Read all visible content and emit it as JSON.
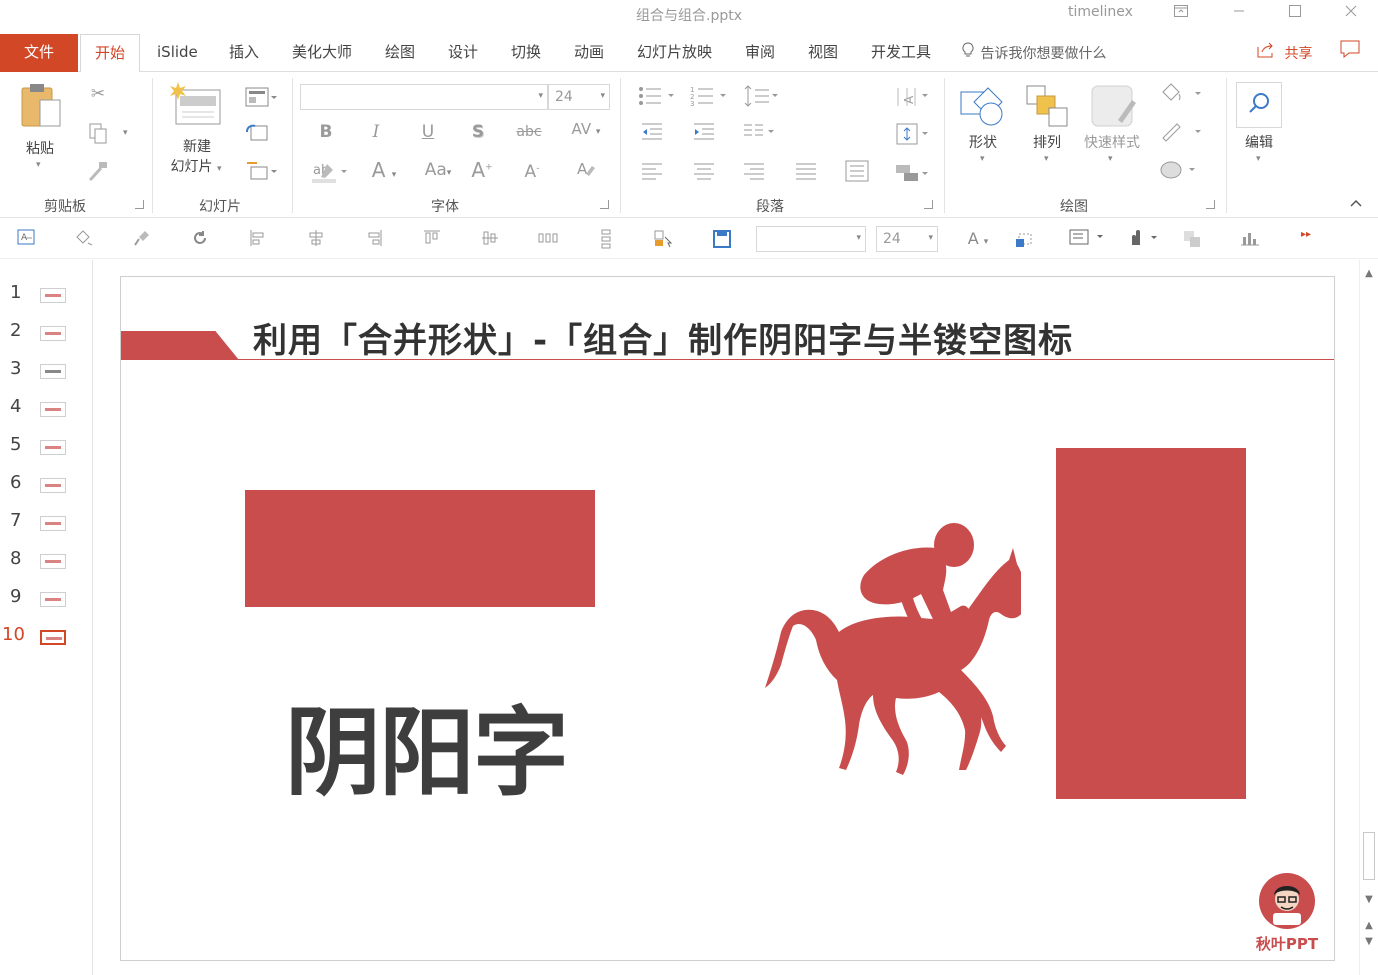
{
  "window": {
    "title": "组合与组合.pptx",
    "user": "timelinex"
  },
  "tabs": {
    "file": "文件",
    "home": "开始",
    "islide": "iSlide",
    "insert": "插入",
    "beautify": "美化大师",
    "draw": "绘图",
    "design": "设计",
    "transitions": "切换",
    "animations": "动画",
    "slideshow": "幻灯片放映",
    "review": "审阅",
    "view": "视图",
    "developer": "开发工具",
    "tell_me": "告诉我你想要做什么",
    "share": "共享"
  },
  "ribbon": {
    "clipboard": {
      "paste": "粘贴",
      "label": "剪贴板"
    },
    "slides": {
      "new_slide_line1": "新建",
      "new_slide_line2": "幻灯片",
      "label": "幻灯片"
    },
    "font": {
      "size": "24",
      "label": "字体",
      "change_case": "Aa",
      "spacing": "AV"
    },
    "paragraph": {
      "label": "段落"
    },
    "drawing": {
      "shapes": "形状",
      "arrange": "排列",
      "quick_styles": "快速样式",
      "label": "绘图"
    },
    "editing": {
      "label": "编辑"
    }
  },
  "qat": {
    "font_size": "24"
  },
  "thumbnails": [
    {
      "num": "1"
    },
    {
      "num": "2"
    },
    {
      "num": "3"
    },
    {
      "num": "4"
    },
    {
      "num": "5"
    },
    {
      "num": "6"
    },
    {
      "num": "7"
    },
    {
      "num": "8"
    },
    {
      "num": "9"
    },
    {
      "num": "10"
    }
  ],
  "slide": {
    "title": "利用「合并形状」-「组合」制作阴阳字与半镂空图标",
    "big_text": "阴阳字",
    "logo_text": "秋叶PPT"
  },
  "colors": {
    "accent": "#d24726",
    "slide_red": "#c94d4d",
    "text_dark": "#3e3e3e"
  }
}
